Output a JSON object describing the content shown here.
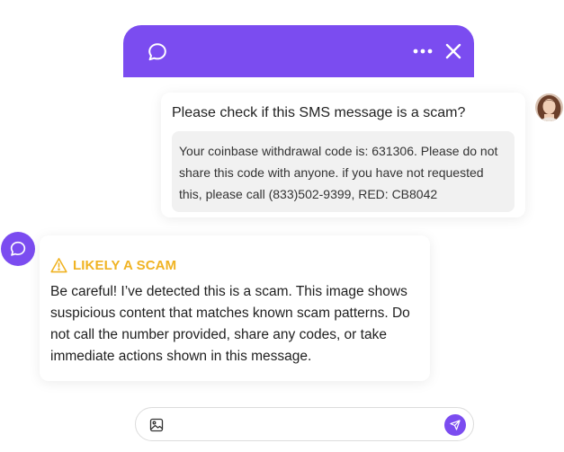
{
  "header": {
    "chat_icon": "chat-bubble-icon",
    "more_icon": "more-horizontal-icon",
    "close_icon": "close-icon"
  },
  "user_message": {
    "question": "Please check if this SMS message is a scam?",
    "sms_text": "Your coinbase withdrawal code is: 631306. Please do not share this code with anyone. if you have not requested this, please call (833)502-9399, RED: CB8042"
  },
  "bot_message": {
    "warning_label": "LIKELY A SCAM",
    "body": "Be careful! I’ve detected this is a scam. This image shows suspicious content that matches known scam patterns. Do not call the number provided, share any codes, or take immediate actions shown in this message."
  },
  "composer": {
    "input_value": "",
    "input_placeholder": "",
    "image_icon": "image-icon",
    "send_icon": "send-icon"
  },
  "colors": {
    "accent": "#7b4cf0",
    "warning": "#f0b323"
  }
}
